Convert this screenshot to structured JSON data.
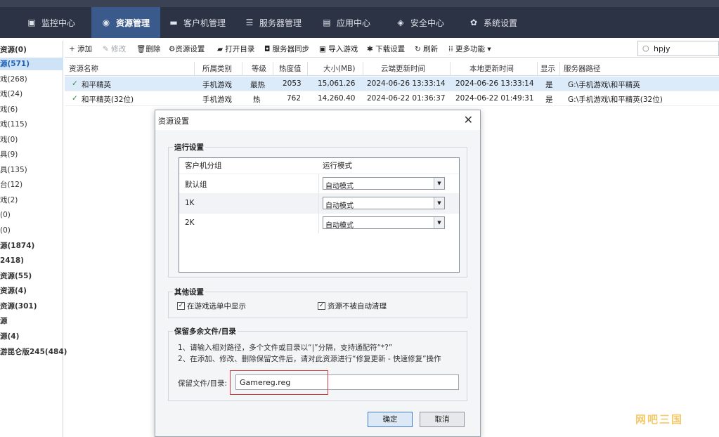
{
  "topnav": {
    "tabs": [
      {
        "label": "监控中心",
        "icon": "monitor-icon"
      },
      {
        "label": "资源管理",
        "icon": "gamepad-icon",
        "active": true
      },
      {
        "label": "客户机管理",
        "icon": "desktop-icon"
      },
      {
        "label": "服务器管理",
        "icon": "server-icon"
      },
      {
        "label": "应用中心",
        "icon": "apps-icon"
      },
      {
        "label": "安全中心",
        "icon": "shield-icon"
      },
      {
        "label": "系统设置",
        "icon": "gear-icon"
      }
    ]
  },
  "sidebar": {
    "items": [
      {
        "label": "资源(0)",
        "bold": true
      },
      {
        "label": "源(571)",
        "selected": true
      },
      {
        "label": "戏(268)"
      },
      {
        "label": "戏(24)"
      },
      {
        "label": "戏(6)"
      },
      {
        "label": "戏(115)"
      },
      {
        "label": "戏(0)"
      },
      {
        "label": "具(9)"
      },
      {
        "label": "具(135)"
      },
      {
        "label": "台(12)"
      },
      {
        "label": "戏(2)"
      },
      {
        "label": "(0)"
      },
      {
        "label": "(0)"
      },
      {
        "label": "源(1874)",
        "bold": true
      },
      {
        "label": "2418)",
        "bold": true
      },
      {
        "label": "资源(55)",
        "bold": true
      },
      {
        "label": "资源(4)",
        "bold": true
      },
      {
        "label": "资源(301)",
        "bold": true
      },
      {
        "label": "源",
        "bold": true
      },
      {
        "label": "源(4)",
        "bold": true
      },
      {
        "label": "游昆仑版245(484)",
        "bold": true
      }
    ]
  },
  "toolbar": {
    "add": "+ 添加",
    "edit": "修改",
    "delete": "删除",
    "resource_settings": "资源设置",
    "open_dir": "打开目录",
    "server_sync": "服务器同步",
    "import_game": "导入游戏",
    "download_settings": "下载设置",
    "refresh": "刷新",
    "more": "更多功能",
    "search_value": "hpjy"
  },
  "table": {
    "columns": [
      "资源名称",
      "所属类别",
      "等级",
      "热度值",
      "大小(MB)",
      "云端更新时间",
      "本地更新时间",
      "显示",
      "服务器路径"
    ],
    "rows": [
      {
        "name": "和平精英",
        "category": "手机游戏",
        "level": "最热",
        "heat": "2053",
        "size": "15,061.26",
        "cloud_time": "2024-06-26 13:33:14",
        "local_time": "2024-06-26 13:33:14",
        "show": "是",
        "path": "G:\\手机游戏\\和平精英"
      },
      {
        "name": "和平精英(32位)",
        "category": "手机游戏",
        "level": "热",
        "heat": "762",
        "size": "14,260.40",
        "cloud_time": "2024-06-22 01:36:37",
        "local_time": "2024-06-22 01:49:31",
        "show": "是",
        "path": "G:\\手机游戏\\和平精英(32位)"
      }
    ]
  },
  "dialog": {
    "title": "资源设置",
    "run_settings": {
      "label": "运行设置",
      "col_group": "客户机分组",
      "col_mode": "运行模式",
      "rows": [
        {
          "group": "默认组",
          "mode": "自动模式"
        },
        {
          "group": "1K",
          "mode": "自动模式"
        },
        {
          "group": "2K",
          "mode": "自动模式"
        }
      ]
    },
    "other_settings": {
      "label": "其他设置",
      "show_in_menu": "在游戏选单中显示",
      "no_auto_clean": "资源不被自动清理"
    },
    "keep_files": {
      "label": "保留多余文件/目录",
      "note1": "1、请输入相对路径，多个文件或目录以“|”分隔，支持通配符“*?”",
      "note2": "2、在添加、修改、删除保留文件后，请对此资源进行“修复更新 - 快速修复”操作",
      "field_label": "保留文件/目录:",
      "field_value": "Gamereg.reg"
    },
    "ok": "确定",
    "cancel": "取消"
  },
  "watermark": "网吧三国"
}
